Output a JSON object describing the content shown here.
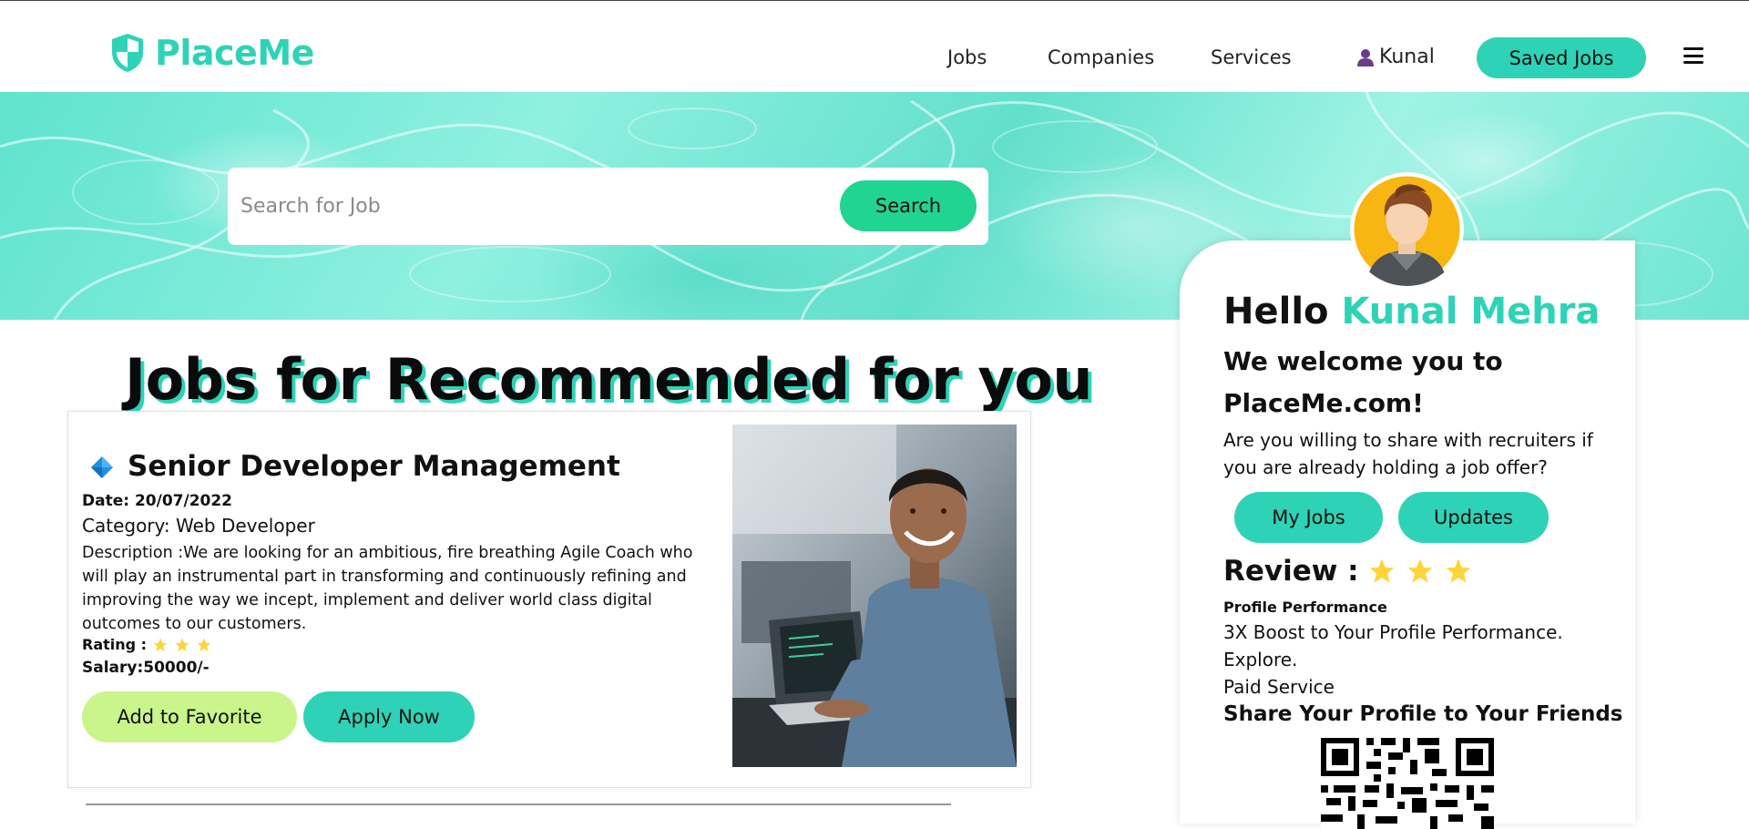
{
  "brand": {
    "name": "PlaceMe",
    "accent": "#2ed3b7"
  },
  "nav": {
    "items": [
      {
        "label": "Jobs"
      },
      {
        "label": "Companies"
      },
      {
        "label": "Services"
      }
    ],
    "user_label": "Kunal",
    "saved_jobs_label": "Saved Jobs"
  },
  "search": {
    "placeholder": "Search for Job",
    "button_label": "Search"
  },
  "section_title": "Jobs for Recommended for you",
  "job": {
    "title": "Senior Developer Management",
    "date": "Date: 20/07/2022",
    "category": "Category: Web Developer",
    "description": "Description :We are looking for an ambitious, fire breathing Agile Coach who will play an instrumental part in transforming and continuously refining and improving the way we incept, implement and deliver world class digital outcomes to our customers.",
    "rating_label": "Rating :",
    "rating_stars": 3,
    "salary": "Salary:50000/-",
    "favorite_label": "Add to Favorite",
    "apply_label": "Apply Now"
  },
  "profile": {
    "hello": "Hello",
    "name": "Kunal Mehra",
    "welcome": "We welcome you to PlaceMe.com!",
    "question": "Are you willing to share with recruiters if you are already holding a job offer?",
    "my_jobs_label": "My Jobs",
    "updates_label": "Updates",
    "review_label": "Review :",
    "review_stars": 3,
    "performance_label": "Profile Performance",
    "performance_lines": [
      "3X Boost to Your Profile Performance.",
      "Explore.",
      "Paid Service"
    ],
    "share_title": "Share Your Profile to Your Friends"
  },
  "colors": {
    "accent": "#2ed3b7",
    "search_button": "#21d491",
    "favorite_button": "#c9f58a",
    "star": "#ffd43b"
  }
}
